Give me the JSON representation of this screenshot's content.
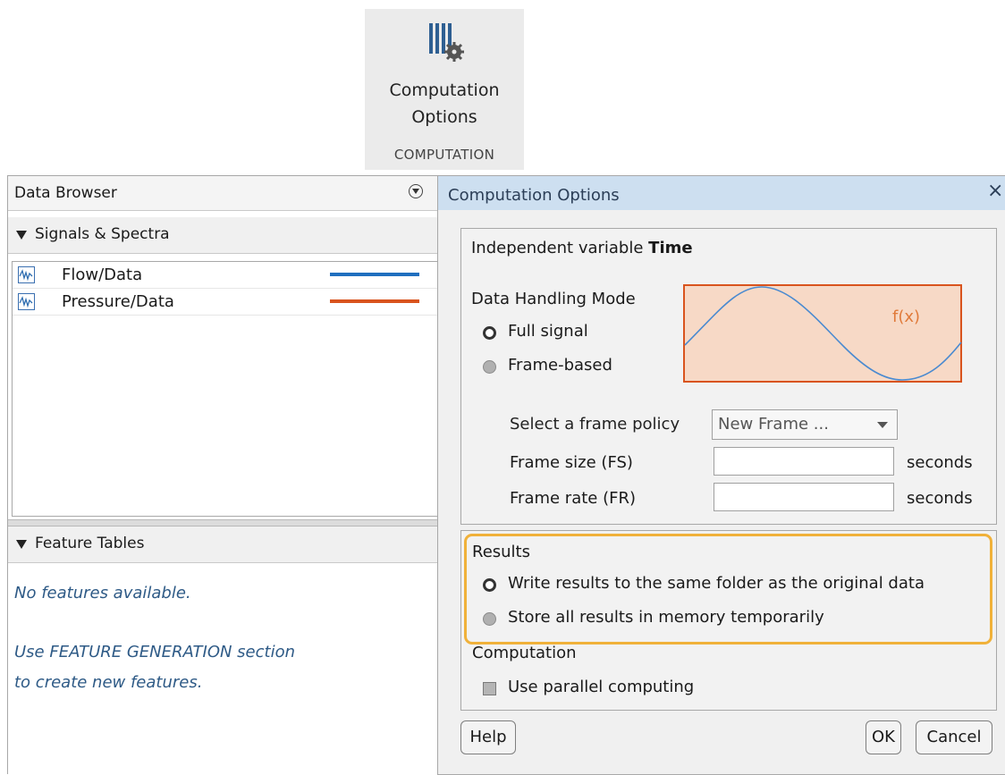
{
  "toolstrip": {
    "button_label_line1": "Computation",
    "button_label_line2": "Options",
    "section_label": "COMPUTATION",
    "icon": "computation-options-icon"
  },
  "data_browser": {
    "title": "Data Browser",
    "signals_section": "Signals & Spectra",
    "signals": [
      {
        "name": "Flow/Data",
        "color": "#1f6fbf"
      },
      {
        "name": "Pressure/Data",
        "color": "#d9541e"
      }
    ],
    "features_section": "Feature Tables",
    "no_features_msg": "No features available.",
    "help_line1": "Use FEATURE GENERATION section",
    "help_line2": "to create new features."
  },
  "dialog": {
    "title": "Computation Options",
    "close_glyph": "×",
    "independent_variable_label": "Independent variable",
    "independent_variable_value": "Time",
    "data_handling_label": "Data Handling Mode",
    "mode_options": [
      {
        "label": "Full signal",
        "selected": true
      },
      {
        "label": "Frame-based",
        "selected": false
      }
    ],
    "plot_label": "f(x)",
    "frame_policy_label": "Select a frame policy",
    "frame_policy_value": "New Frame ...",
    "frame_size_label": "Frame size (FS)",
    "frame_size_value": "",
    "frame_size_unit": "seconds",
    "frame_rate_label": "Frame rate (FR)",
    "frame_rate_value": "",
    "frame_rate_unit": "seconds",
    "results_label": "Results",
    "results_options": [
      {
        "label": "Write results to the same folder as the original data",
        "selected": true
      },
      {
        "label": "Store all results in memory temporarily",
        "selected": false
      }
    ],
    "computation_label": "Computation",
    "parallel_label": "Use parallel computing",
    "parallel_checked": false,
    "help_button": "Help",
    "ok_button": "OK",
    "cancel_button": "Cancel"
  },
  "colors": {
    "highlight": "#f0b13a",
    "plot_fill": "#f7d9c6",
    "plot_border": "#d9541e",
    "title_bar": "#cddff0"
  }
}
